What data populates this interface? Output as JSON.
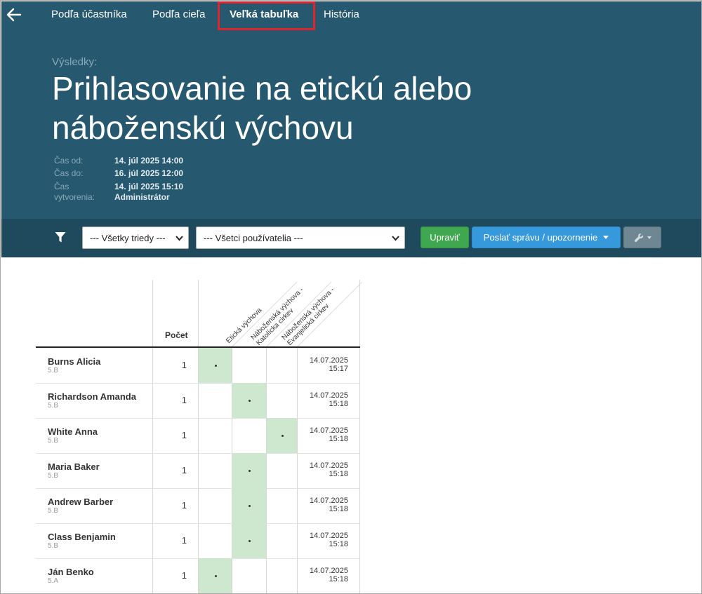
{
  "nav": {
    "back_icon": "arrow-left-icon",
    "tabs": [
      {
        "label": "Podľa účastníka",
        "active": false
      },
      {
        "label": "Podľa cieľa",
        "active": false
      },
      {
        "label": "Veľká tabuľka",
        "active": true
      },
      {
        "label": "História",
        "active": false
      }
    ]
  },
  "header": {
    "subtitle": "Výsledky:",
    "title": "Prihlasovanie na etickú alebo náboženskú výchovu",
    "meta": {
      "from_label": "Čas od:",
      "from_value": "14. júl 2025 14:00",
      "to_label": "Čas do:",
      "to_value": "16. júl 2025 12:00",
      "created_label_1": "Čas",
      "created_label_2": "vytvorenia:",
      "created_value": "14. júl 2025 15:10",
      "created_by": "Administrátor"
    }
  },
  "toolbar": {
    "filter_icon": "filter-icon",
    "class_select": "--- Všetky triedy ---",
    "user_select": "--- Všetci používatelia ---",
    "edit_button": "Upraviť",
    "send_button": "Poslať správu / upozornenie",
    "tools_icon": "wrench-icon"
  },
  "table": {
    "count_header": "Počet",
    "options": [
      {
        "line1": "Etická výchova",
        "line2": ""
      },
      {
        "line1": "Náboženská výchova -",
        "line2": "Katolícka cirkev"
      },
      {
        "line1": "Náboženská výchova -",
        "line2": "Evanjelická cirkev"
      }
    ],
    "rows": [
      {
        "name": "Burns Alicia",
        "class": "5.B",
        "count": "1",
        "choice": 0,
        "date": "14.07.2025",
        "time": "15:17"
      },
      {
        "name": "Richardson Amanda",
        "class": "5.B",
        "count": "1",
        "choice": 1,
        "date": "14.07.2025",
        "time": "15:18"
      },
      {
        "name": "White Anna",
        "class": "5.B",
        "count": "1",
        "choice": 2,
        "date": "14.07.2025",
        "time": "15:18"
      },
      {
        "name": "Maria Baker",
        "class": "5.B",
        "count": "1",
        "choice": 1,
        "date": "14.07.2025",
        "time": "15:18"
      },
      {
        "name": "Andrew Barber",
        "class": "5.B",
        "count": "1",
        "choice": 1,
        "date": "14.07.2025",
        "time": "15:18"
      },
      {
        "name": "Class Benjamin",
        "class": "5.B",
        "count": "1",
        "choice": 1,
        "date": "14.07.2025",
        "time": "15:18"
      },
      {
        "name": "Ján Benko",
        "class": "5.A",
        "count": "1",
        "choice": 0,
        "date": "14.07.2025",
        "time": "15:18"
      }
    ]
  },
  "colors": {
    "header_bg": "#26596f",
    "toolbar_bg": "#1f4a5d",
    "edit_green": "#3ea74f",
    "send_blue": "#3699dc",
    "tools_grey": "#6f8793",
    "selected_cell": "#cde8cf",
    "active_tab_outline": "#e0242b"
  }
}
